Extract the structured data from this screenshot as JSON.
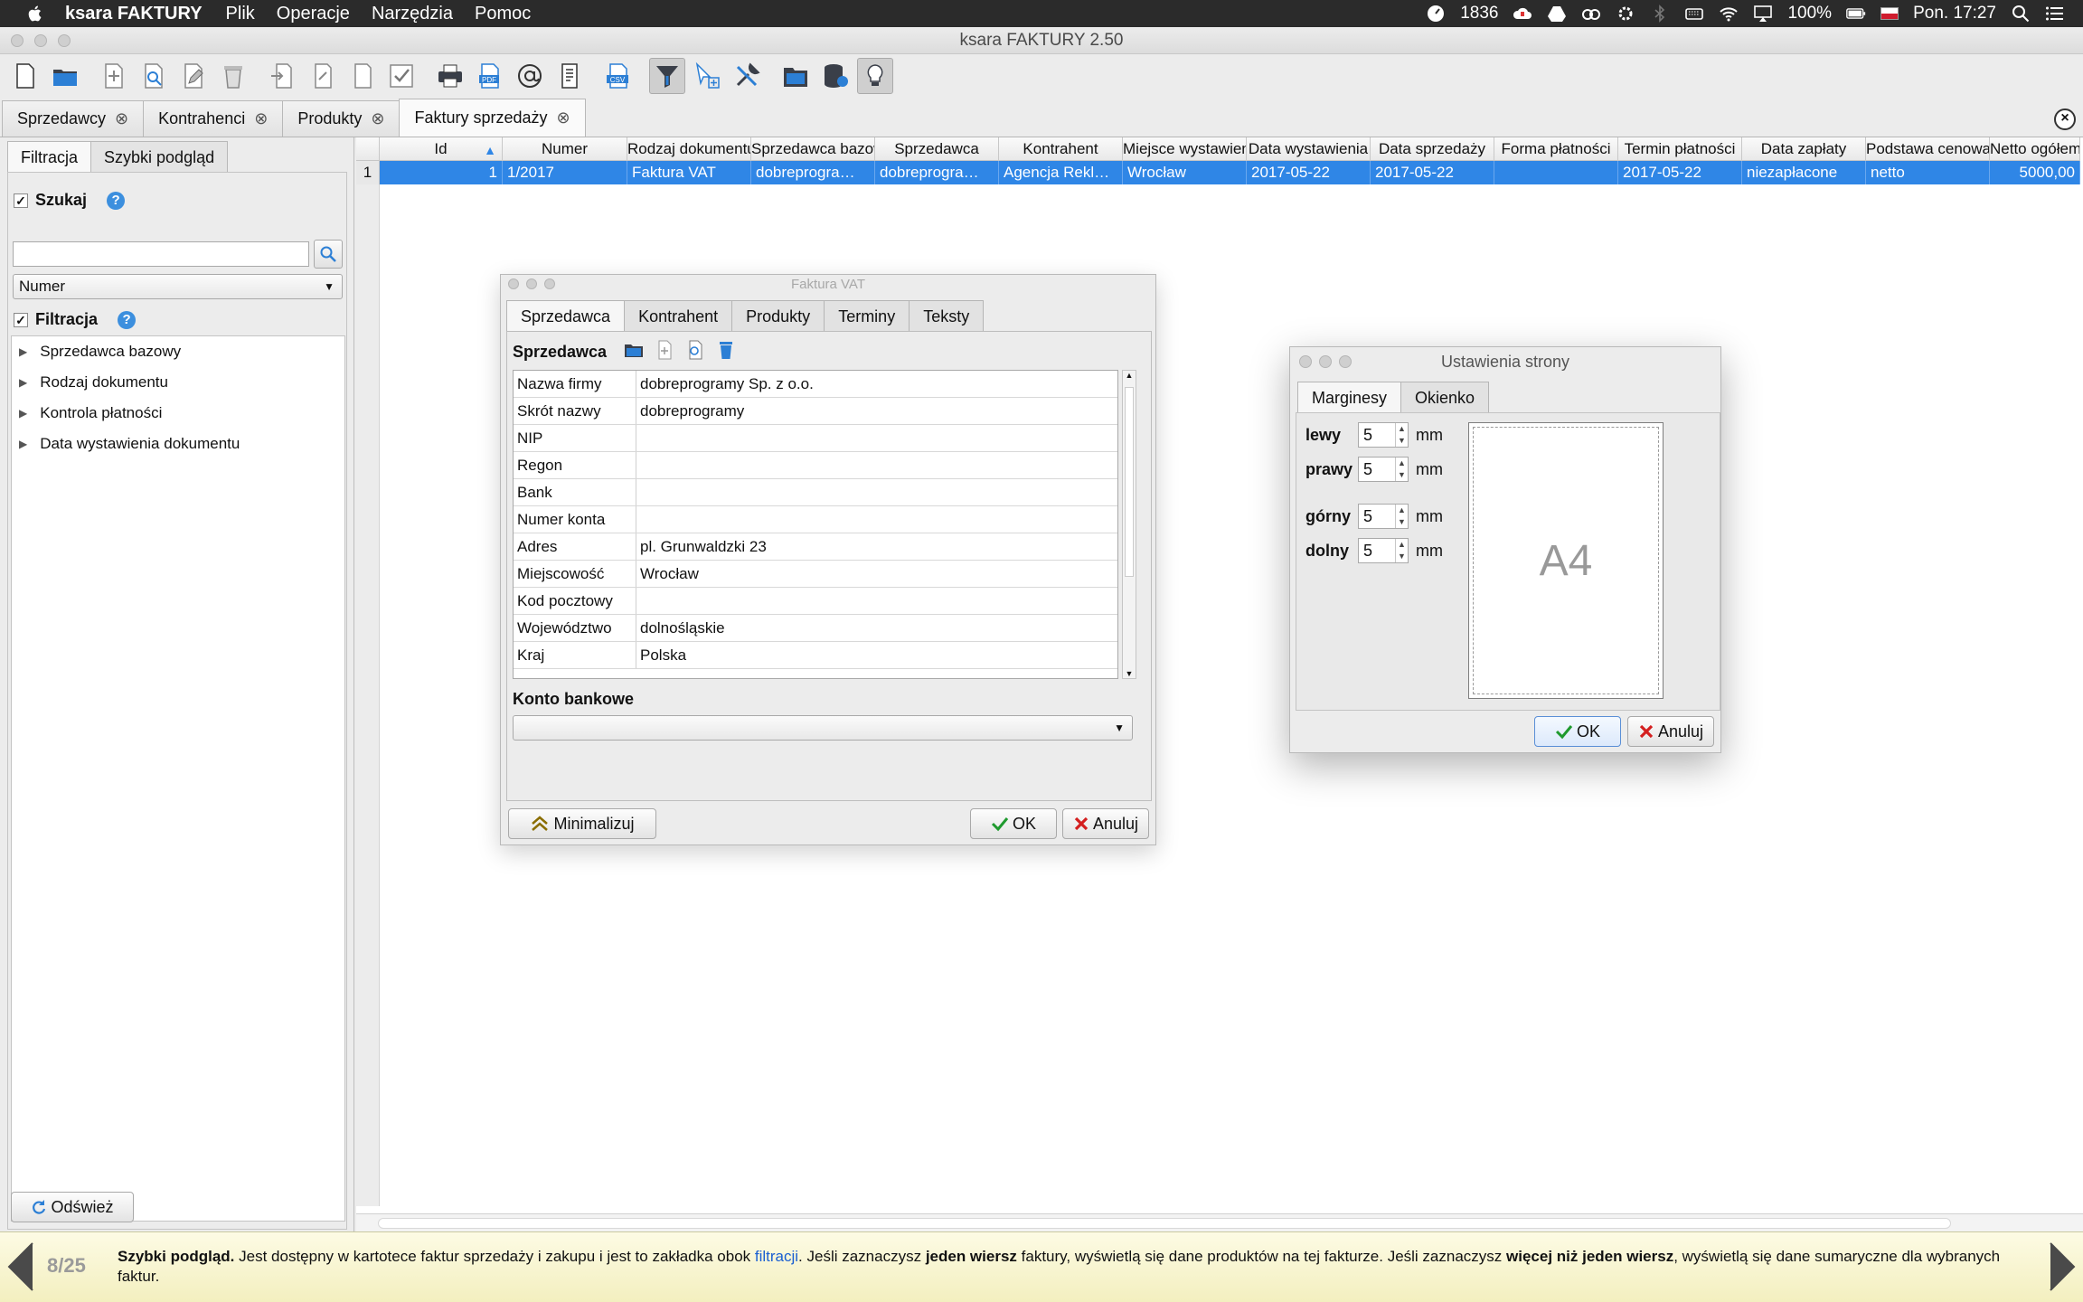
{
  "menubar": {
    "app_name": "ksara FAKTURY",
    "items": [
      "Plik",
      "Operacje",
      "Narzędzia",
      "Pomoc"
    ],
    "status_count": "1836",
    "battery": "100%",
    "clock": "Pon. 17:27"
  },
  "window": {
    "title": "ksara FAKTURY 2.50"
  },
  "toolbar": {
    "icons": [
      "new-document-icon",
      "open-folder-icon",
      "add-document-icon",
      "preview-document-icon",
      "edit-document-icon",
      "delete-icon",
      "import-icon",
      "copy-icon",
      "blank-page-icon",
      "approve-icon",
      "print-icon",
      "pdf-icon",
      "email-icon",
      "report-icon",
      "csv-icon",
      "filter-icon",
      "select-add-icon",
      "tools-icon",
      "folder-icon",
      "database-icon",
      "lightbulb-icon"
    ]
  },
  "doc_tabs": [
    {
      "label": "Sprzedawcy"
    },
    {
      "label": "Kontrahenci"
    },
    {
      "label": "Produkty"
    },
    {
      "label": "Faktury sprzedaży"
    }
  ],
  "left_panel": {
    "tabs": [
      "Filtracja",
      "Szybki podgląd"
    ],
    "search_label": "Szukaj",
    "search_value": "",
    "search_field": "Numer",
    "filter_label": "Filtracja",
    "tree": [
      "Sprzedawca bazowy",
      "Rodzaj dokumentu",
      "Kontrola płatności",
      "Data wystawienia dokumentu"
    ],
    "refresh_label": "Odśwież"
  },
  "table": {
    "columns": [
      "Id",
      "Numer",
      "Rodzaj dokumentu",
      "Sprzedawca bazowy",
      "Sprzedawca",
      "Kontrahent",
      "Miejsce wystawienia",
      "Data wystawienia",
      "Data sprzedaży",
      "Forma płatności",
      "Termin płatności",
      "Data zapłaty",
      "Podstawa cenowa",
      "Netto ogółem"
    ],
    "rows": [
      {
        "row_num": "1",
        "cells": [
          "1",
          "1/2017",
          "Faktura VAT",
          "dobreprogra…",
          "dobreprogra…",
          "Agencja Rekl…",
          "Wrocław",
          "2017-05-22",
          "2017-05-22",
          "",
          "2017-05-22",
          "niezapłacone",
          "netto",
          "5000,00"
        ]
      }
    ]
  },
  "faktura_dialog": {
    "title": "Faktura VAT",
    "tabs": [
      "Sprzedawca",
      "Kontrahent",
      "Produkty",
      "Terminy",
      "Teksty"
    ],
    "section_label": "Sprzedawca",
    "fields": [
      {
        "key": "Nazwa firmy",
        "value": "dobreprogramy Sp. z o.o."
      },
      {
        "key": "Skrót nazwy",
        "value": "dobreprogramy"
      },
      {
        "key": "NIP",
        "value": ""
      },
      {
        "key": "Regon",
        "value": ""
      },
      {
        "key": "Bank",
        "value": ""
      },
      {
        "key": "Numer konta",
        "value": ""
      },
      {
        "key": "Adres",
        "value": "pl. Grunwaldzki 23"
      },
      {
        "key": "Miejscowość",
        "value": "Wrocław"
      },
      {
        "key": "Kod pocztowy",
        "value": ""
      },
      {
        "key": "Województwo",
        "value": "dolnośląskie"
      },
      {
        "key": "Kraj",
        "value": "Polska"
      }
    ],
    "bank_label": "Konto bankowe",
    "bank_value": "",
    "minimize_label": "Minimalizuj",
    "ok_label": "OK",
    "cancel_label": "Anuluj"
  },
  "page_dialog": {
    "title": "Ustawienia strony",
    "tabs": [
      "Marginesy",
      "Okienko"
    ],
    "margins": [
      {
        "label": "lewy",
        "value": "5",
        "unit": "mm"
      },
      {
        "label": "prawy",
        "value": "5",
        "unit": "mm"
      },
      {
        "label": "górny",
        "value": "5",
        "unit": "mm"
      },
      {
        "label": "dolny",
        "value": "5",
        "unit": "mm"
      }
    ],
    "paper": "A4",
    "ok_label": "OK",
    "cancel_label": "Anuluj"
  },
  "statusbar": {
    "page": "8/25",
    "title": "Szybki podgląd.",
    "t1": " Jest dostępny w kartotece faktur sprzedaży i zakupu i jest to zakładka obok ",
    "link": "filtracji",
    "t2": ". Jeśli zaznaczysz ",
    "b1": "jeden wiersz",
    "t3": " faktury, wyświetlą się dane produktów na tej fakturze. Jeśli zaznaczysz ",
    "b2": "więcej niż jeden wiersz",
    "t4": ", wyświetlą się dane sumaryczne dla wybranych faktur."
  }
}
